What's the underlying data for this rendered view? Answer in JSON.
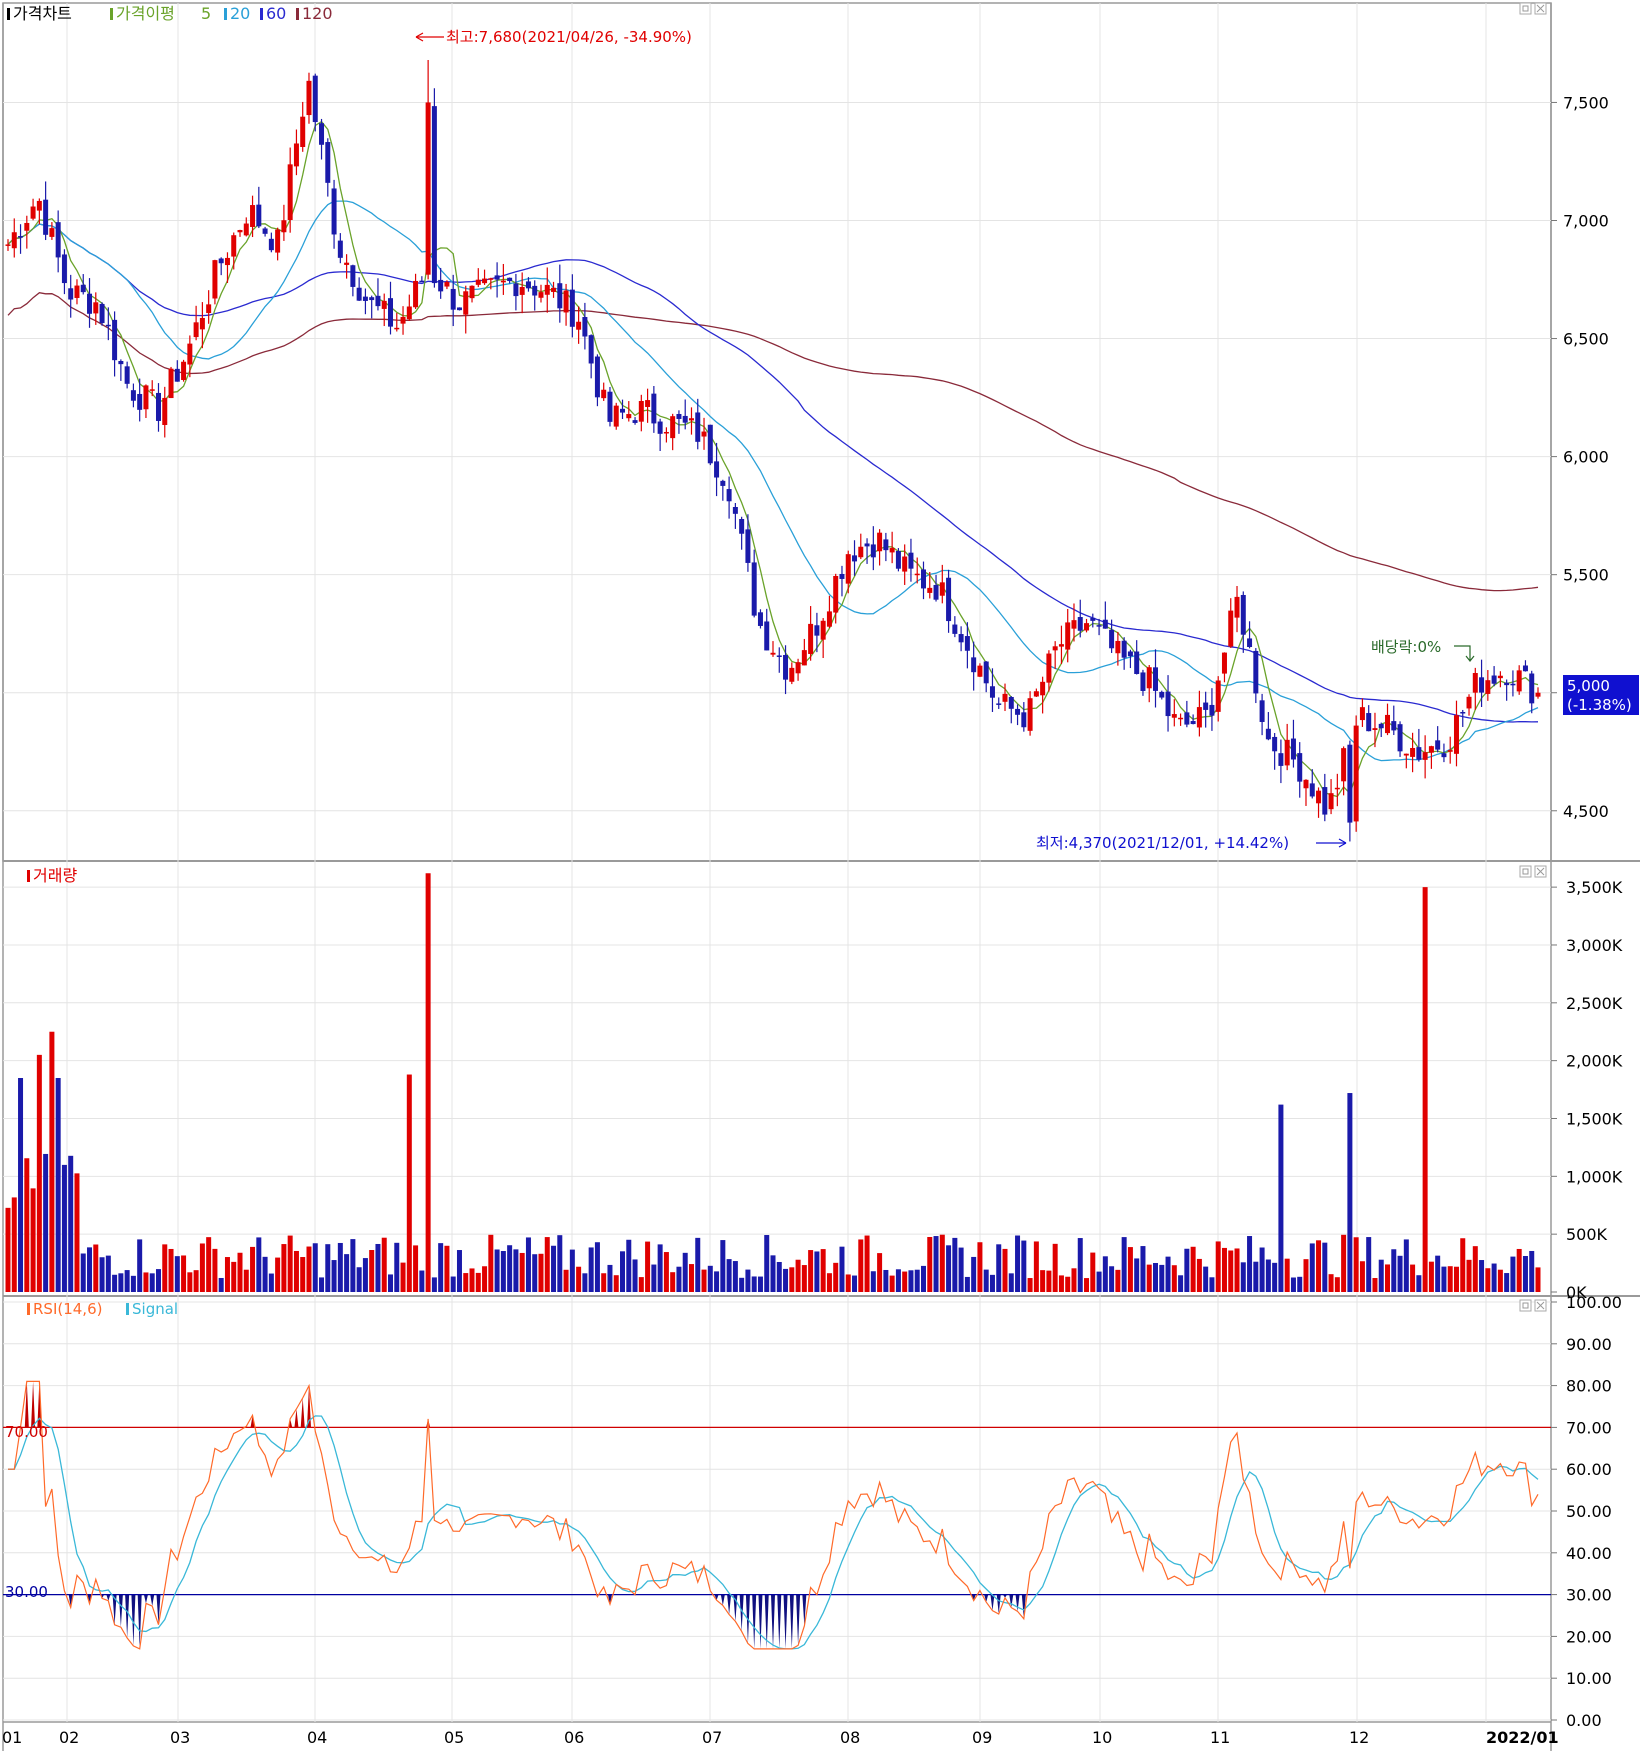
{
  "colors": {
    "up": "#e00000",
    "down": "#1a1aaa",
    "ma5": "#6aa32a",
    "ma20": "#2aa0d8",
    "ma60": "#2a2ad0",
    "ma120": "#8a2a3a",
    "rsi": "#ff6a2a",
    "signal": "#3ab8d8",
    "upper_band": "#d00000",
    "lower_band": "#0000a0",
    "grid": "#e4e4e4",
    "frame": "#9a9a9a",
    "last_price_bg": "#1010d0"
  },
  "panels": {
    "price": {
      "title": "가격차트",
      "legend_label": "가격이평",
      "ma_periods": [
        "5",
        "20",
        "60",
        "120"
      ],
      "y_ticks": [
        "7,500",
        "7,000",
        "6,500",
        "6,000",
        "5,500",
        "5,000",
        "4,500"
      ],
      "high_annotation": "최고:7,680(2021/04/26, -34.90%)",
      "low_annotation": "최저:4,370(2021/12/01, +14.42%)",
      "dividend_annotation": "배당락:0%",
      "last_price": "5,000",
      "last_change": "(-1.38%)"
    },
    "volume": {
      "title": "거래량",
      "y_ticks": [
        "3,500K",
        "3,000K",
        "2,500K",
        "2,000K",
        "1,500K",
        "1,000K",
        "500K",
        "0K"
      ]
    },
    "rsi": {
      "title": "RSI(14,6)",
      "signal_label": "Signal",
      "y_ticks": [
        "100.00",
        "90.00",
        "80.00",
        "70.00",
        "60.00",
        "50.00",
        "40.00",
        "30.00",
        "20.00",
        "10.00",
        "0.00"
      ],
      "upper_label": "70.00",
      "lower_label": "30.00"
    }
  },
  "x_labels": [
    "01",
    "02",
    "03",
    "04",
    "05",
    "06",
    "07",
    "08",
    "09",
    "10",
    "11",
    "12",
    "2022/01"
  ],
  "chart_data": [
    {
      "type": "candlestick",
      "title": "가격차트",
      "x_start": "2021/01",
      "x_end": "2022/01",
      "ylim": [
        4300,
        7900
      ],
      "high": {
        "value": 7680,
        "date": "2021/04/26"
      },
      "low": {
        "value": 4370,
        "date": "2021/12/01"
      },
      "last_close": 5000,
      "change_pct": -1.38,
      "monthly_close_approx": [
        {
          "month": "01",
          "close": 6800
        },
        {
          "month": "02",
          "close": 6700
        },
        {
          "month": "03",
          "close": 6250
        },
        {
          "month": "04",
          "close": 6900
        },
        {
          "month": "05",
          "close": 6800
        },
        {
          "month": "06",
          "close": 6650
        },
        {
          "month": "07",
          "close": 6200
        },
        {
          "month": "08",
          "close": 6150
        },
        {
          "month": "09",
          "close": 5600
        },
        {
          "month": "10",
          "close": 4950
        },
        {
          "month": "11",
          "close": 5150
        },
        {
          "month": "12",
          "close": 4800
        },
        {
          "month": "2022/01",
          "close": 5000
        }
      ],
      "moving_averages": [
        {
          "name": "5",
          "approx_end": 5000
        },
        {
          "name": "20",
          "approx_end": 4990
        },
        {
          "name": "60",
          "approx_end": 5010
        },
        {
          "name": "120",
          "approx_end": 5300
        }
      ]
    },
    {
      "type": "bar",
      "title": "거래량",
      "ylim": [
        0,
        3700000
      ],
      "peaks": [
        {
          "date": "2021/01",
          "value": 2250000
        },
        {
          "date": "2021/03/31",
          "value": 1880000
        },
        {
          "date": "2021/04/26",
          "value": 3620000
        },
        {
          "date": "2021/11/19",
          "value": 1620000
        },
        {
          "date": "2021/12/01",
          "value": 1720000
        },
        {
          "date": "2021/12/29",
          "value": 3500000
        }
      ],
      "typical_range": [
        100000,
        600000
      ]
    },
    {
      "type": "line",
      "title": "RSI(14,6)",
      "ylim": [
        0,
        100
      ],
      "levels": [
        70,
        30
      ],
      "series": [
        {
          "name": "RSI(14,6)",
          "min": 17,
          "max": 81
        },
        {
          "name": "Signal",
          "min": 23,
          "max": 69
        }
      ]
    }
  ]
}
